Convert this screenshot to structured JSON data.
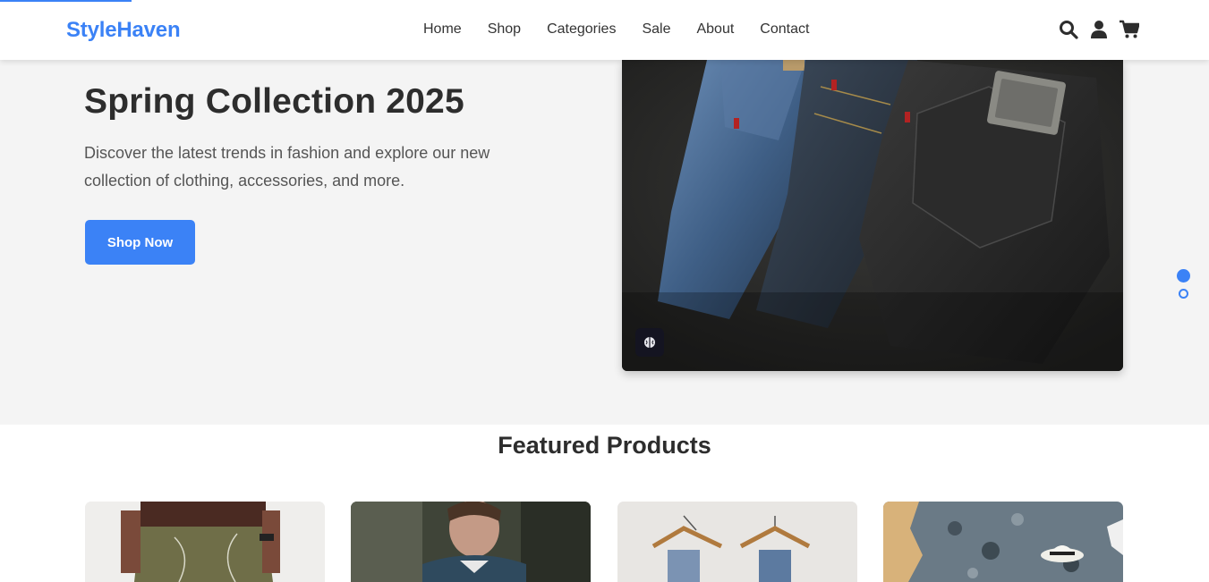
{
  "brand": {
    "name": "StyleHaven",
    "accent": "#3b82f6"
  },
  "nav": {
    "items": [
      {
        "label": "Home"
      },
      {
        "label": "Shop"
      },
      {
        "label": "Categories"
      },
      {
        "label": "Sale"
      },
      {
        "label": "About"
      },
      {
        "label": "Contact"
      }
    ]
  },
  "header_icons": [
    "search-icon",
    "user-icon",
    "cart-icon"
  ],
  "hero": {
    "title": "Spring Collection 2025",
    "description": "Discover the latest trends in fashion and explore our new collection of clothing, accessories, and more.",
    "cta_label": "Shop Now",
    "image": "jeans-photo",
    "slides": {
      "count": 2,
      "active": 1
    }
  },
  "featured": {
    "title": "Featured Products",
    "products": [
      {
        "image": "person-olive-pants-photo"
      },
      {
        "image": "man-denim-jacket-photo"
      },
      {
        "image": "jeans-on-hangers-photo"
      },
      {
        "image": "woman-hat-rocks-photo"
      }
    ]
  }
}
